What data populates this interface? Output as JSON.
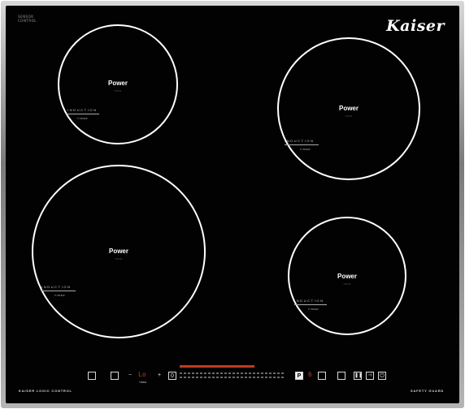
{
  "brand": "Kaiser",
  "corner_label": "SENSOR\nCONTROL",
  "zones": [
    {
      "title": "Power",
      "sub": "kW/W",
      "induction": "INDUCTION",
      "timer": "TIMER"
    },
    {
      "title": "Power",
      "sub": "kW/W",
      "induction": "INDUCTION",
      "timer": "TIMER"
    },
    {
      "title": "Power",
      "sub": "kW/W",
      "induction": "INDUCTION",
      "timer": "TIMER"
    },
    {
      "title": "Power",
      "sub": "kW/W",
      "induction": "INDUCTION",
      "timer": "TIMER"
    }
  ],
  "control": {
    "left_label": "KAISER LOGIC CONTROL",
    "right_label": "SAFETY GUARD",
    "timer_display": "Lo",
    "timer_label": "TIMER",
    "minus": "−",
    "plus": "+",
    "zero": "0",
    "p_button": "P",
    "level_digit": "6",
    "pause_icon": "pause-icon",
    "lock_icon": "lock-icon",
    "power_icon": "power-icon"
  }
}
